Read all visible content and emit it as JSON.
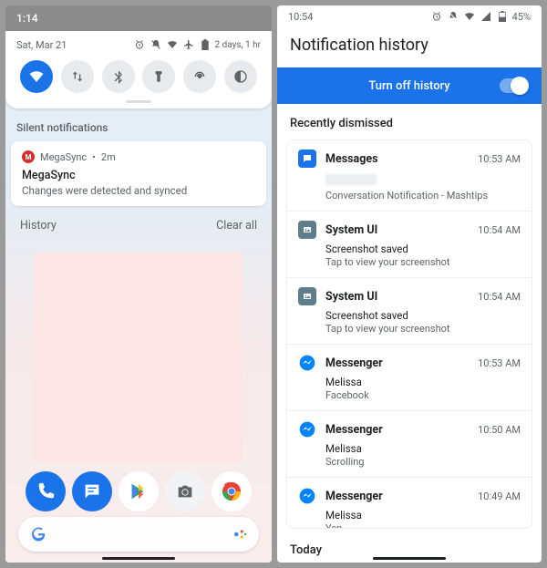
{
  "left": {
    "status_time": "1:14",
    "qs": {
      "date": "Sat, Mar 21",
      "battery_text": "2 days, 1 hr"
    },
    "silent_header": "Silent notifications",
    "notif": {
      "app": "MegaSync",
      "age": "2m",
      "title": "MegaSync",
      "body": "Changes were detected and synced"
    },
    "footer": {
      "history": "History",
      "clear": "Clear all"
    }
  },
  "right": {
    "status_time": "10:54",
    "battery_pct": "45%",
    "title": "Notification history",
    "toggle_label": "Turn off history",
    "section": "Recently dismissed",
    "items": [
      {
        "app": "Messages",
        "time": "10:53 AM",
        "line1": "",
        "line2": "Conversation Notification - Mashtips",
        "icon": "messages",
        "redacted": true
      },
      {
        "app": "System UI",
        "time": "10:54 AM",
        "line1": "Screenshot saved",
        "line2": "Tap to view your screenshot",
        "icon": "system"
      },
      {
        "app": "System UI",
        "time": "10:54 AM",
        "line1": "Screenshot saved",
        "line2": "Tap to view your screenshot",
        "icon": "system"
      },
      {
        "app": "Messenger",
        "time": "10:53 AM",
        "line1": "Melissa",
        "line2": "Facebook",
        "icon": "messenger"
      },
      {
        "app": "Messenger",
        "time": "10:50 AM",
        "line1": "Melissa",
        "line2": "Scrolling",
        "icon": "messenger"
      },
      {
        "app": "Messenger",
        "time": "10:49 AM",
        "line1": "Melissa",
        "line2": "Yep",
        "icon": "messenger"
      }
    ],
    "today": "Today"
  }
}
